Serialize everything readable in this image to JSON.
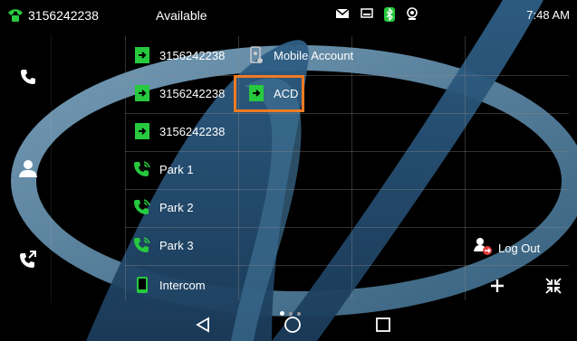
{
  "status_bar": {
    "phone_number": "3156242238",
    "presence": "Available",
    "time": "7:48 AM",
    "icons": [
      "phone-icon",
      "mail-icon",
      "screen-icon",
      "bluetooth-icon",
      "webcam-icon"
    ]
  },
  "rail": {
    "items": [
      {
        "name": "call-icon"
      },
      {
        "name": "contacts-icon"
      },
      {
        "name": "transfer-call-icon"
      }
    ]
  },
  "dsskeys": {
    "col1": [
      {
        "label": "3156242238",
        "icon": "line-icon"
      },
      {
        "label": "3156242238",
        "icon": "line-icon"
      },
      {
        "label": "3156242238",
        "icon": "line-icon"
      },
      {
        "label": "Park 1",
        "icon": "park-icon"
      },
      {
        "label": "Park 2",
        "icon": "park-icon"
      },
      {
        "label": "Park 3",
        "icon": "park-icon"
      },
      {
        "label": "Intercom",
        "icon": "intercom-icon"
      }
    ],
    "col2": [
      {
        "label": "Mobile Account",
        "icon": "mobile-account-icon"
      },
      {
        "label": "ACD",
        "icon": "acd-icon"
      }
    ],
    "logout_label": "Log Out"
  },
  "colors": {
    "accent_green": "#27c93f",
    "highlight_orange": "#f07a22",
    "logout_red": "#e23b3b",
    "wallpaper_blue": "#6fa3c4"
  },
  "page_indicator": {
    "pages": 3,
    "active": 1
  }
}
